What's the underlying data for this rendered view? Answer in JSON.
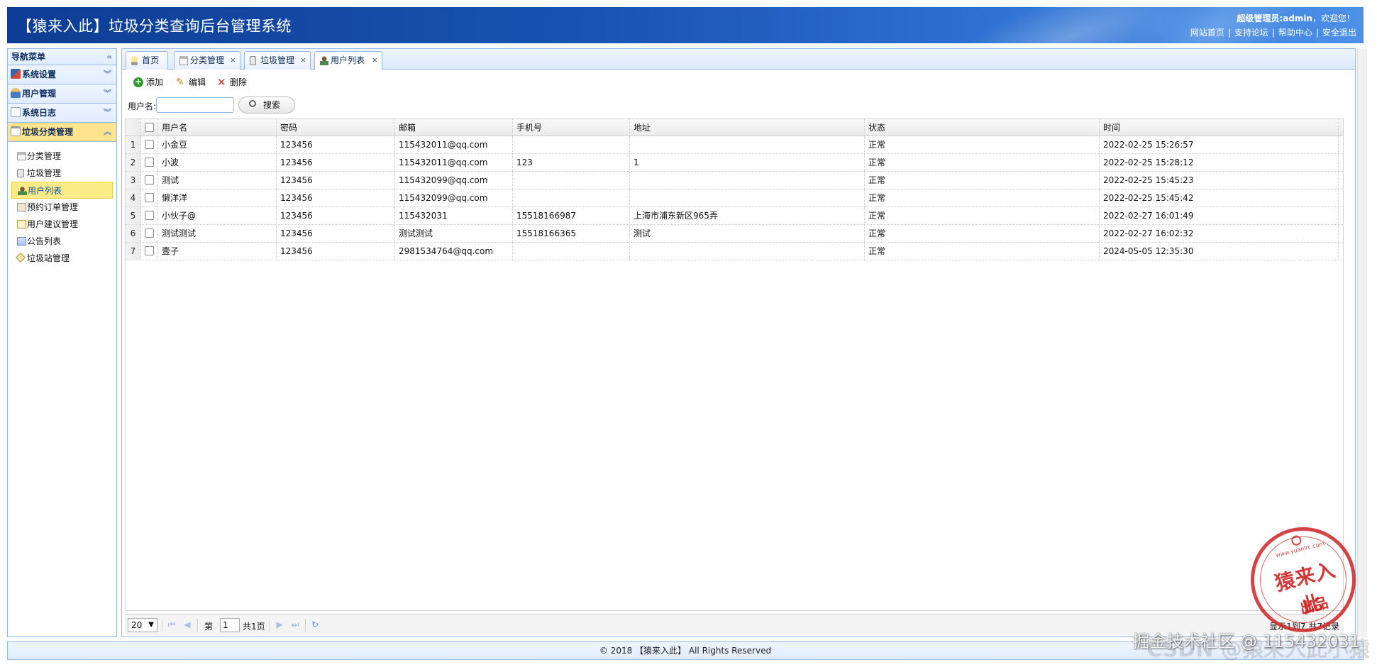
{
  "header": {
    "title": "【猿来入此】垃圾分类查询后台管理系统",
    "welcome_bold": "超级管理员:admin",
    "welcome_tail": "，欢迎您！",
    "links": [
      "网站首页",
      "支持论坛",
      "帮助中心",
      "安全退出"
    ]
  },
  "nav": {
    "title": "导航菜单",
    "collapse_glyph": "«",
    "groups": [
      {
        "label": "系统设置",
        "icon": "tools-icon",
        "color": "#d04a3a"
      },
      {
        "label": "用户管理",
        "icon": "users-icon",
        "color": "#4a78c2"
      },
      {
        "label": "系统日志",
        "icon": "log-icon",
        "color": "#8aa4c8"
      },
      {
        "label": "垃圾分类管理",
        "icon": "trash-icon",
        "color": "#9a9a9a"
      }
    ],
    "items": [
      {
        "label": "分类管理",
        "icon": "building-icon"
      },
      {
        "label": "垃圾管理",
        "icon": "bin-icon"
      },
      {
        "label": "用户列表",
        "icon": "user-icon"
      },
      {
        "label": "预约订单管理",
        "icon": "order-icon"
      },
      {
        "label": "用户建议管理",
        "icon": "suggestion-icon"
      },
      {
        "label": "公告列表",
        "icon": "notice-icon"
      },
      {
        "label": "垃圾站管理",
        "icon": "tag-icon"
      }
    ]
  },
  "tabs": [
    {
      "label": "首页",
      "closable": false
    },
    {
      "label": "分类管理",
      "closable": true
    },
    {
      "label": "垃圾管理",
      "closable": true
    },
    {
      "label": "用户列表",
      "closable": true
    }
  ],
  "toolbar": {
    "add": "添加",
    "edit": "编辑",
    "delete": "删除"
  },
  "search": {
    "label": "用户名:",
    "value": "",
    "button": "搜索"
  },
  "grid": {
    "columns": [
      "用户名",
      "密码",
      "邮箱",
      "手机号",
      "地址",
      "状态",
      "时间"
    ],
    "rows": [
      {
        "num": "1",
        "cells": [
          "小金豆",
          "123456",
          "115432011@qq.com",
          "",
          "",
          "正常",
          "2022-02-25 15:26:57"
        ]
      },
      {
        "num": "2",
        "cells": [
          "小波",
          "123456",
          "115432011@qq.com",
          "123",
          "1",
          "正常",
          "2022-02-25 15:28:12"
        ]
      },
      {
        "num": "3",
        "cells": [
          "测试",
          "123456",
          "115432099@qq.com",
          "",
          "",
          "正常",
          "2022-02-25 15:45:23"
        ]
      },
      {
        "num": "4",
        "cells": [
          "懒洋洋",
          "123456",
          "115432099@qq.com",
          "",
          "",
          "正常",
          "2022-02-25 15:45:42"
        ]
      },
      {
        "num": "5",
        "cells": [
          "小伙子@",
          "123456",
          "115432031",
          "15518166987",
          "上海市浦东新区965弄",
          "正常",
          "2022-02-27 16:01:49"
        ]
      },
      {
        "num": "6",
        "cells": [
          "测试测试",
          "123456",
          "测试测试",
          "15518166365",
          "测试",
          "正常",
          "2022-02-27 16:02:32"
        ]
      },
      {
        "num": "7",
        "cells": [
          "壹子",
          "123456",
          "2981534764@qq.com",
          "",
          "",
          "正常",
          "2024-05-05 12:35:30"
        ]
      }
    ]
  },
  "pager": {
    "page_size": "20",
    "page_prefix": "第",
    "page_value": "1",
    "page_total": "共1页",
    "info": "显示1到7,共7记录"
  },
  "footer": {
    "text": "© 2018 【猿来入此】 All Rights Reserved"
  },
  "stamp": {
    "main": "猿来入此",
    "sub": "出品",
    "url": "www.yuanlrc.com"
  },
  "watermark": {
    "text": "掘金技术社区 @ 115432031",
    "faint": "CSDN @猿来入此小猿"
  },
  "colors": {
    "header_bg": "#1a55b4",
    "nav_active": "#ffe48d",
    "selected_item": "#fbec88",
    "stamp": "#cd2323"
  }
}
